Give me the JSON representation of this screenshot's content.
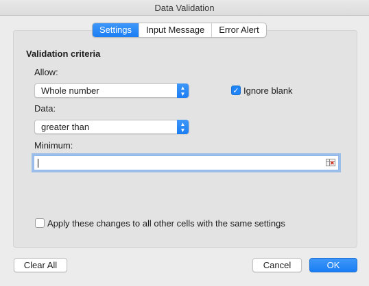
{
  "window": {
    "title": "Data Validation"
  },
  "tabs": [
    {
      "label": "Settings",
      "active": true
    },
    {
      "label": "Input Message",
      "active": false
    },
    {
      "label": "Error Alert",
      "active": false
    }
  ],
  "criteria": {
    "section_title": "Validation criteria",
    "allow_label": "Allow:",
    "allow_value": "Whole number",
    "ignore_blank_label": "Ignore blank",
    "ignore_blank_checked": true,
    "data_label": "Data:",
    "data_value": "greater than",
    "minimum_label": "Minimum:",
    "minimum_value": ""
  },
  "apply_all": {
    "label": "Apply these changes to all other cells with the same settings",
    "checked": false
  },
  "buttons": {
    "clear_all": "Clear All",
    "cancel": "Cancel",
    "ok": "OK"
  },
  "icons": {
    "check": "checkmark-icon",
    "stepper": "up-down-chevron-icon",
    "range": "range-selector-icon"
  },
  "colors": {
    "accent": "#1a7ef4",
    "focus_ring": "#66a0f0",
    "background": "#ececec"
  }
}
